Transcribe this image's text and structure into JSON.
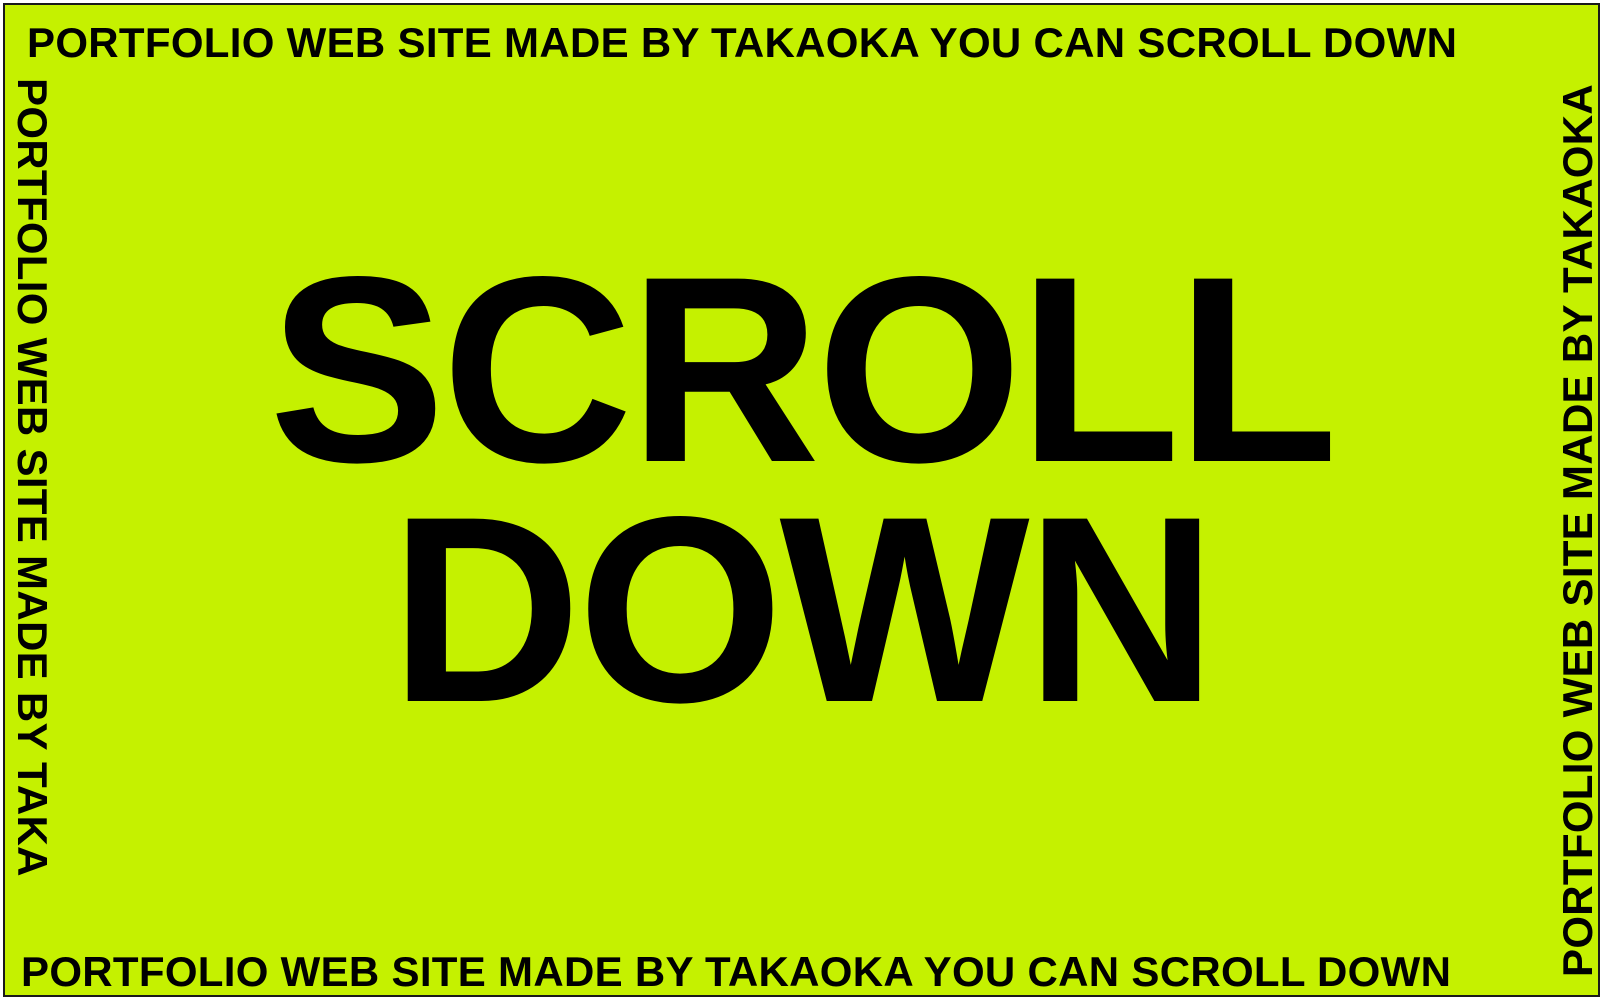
{
  "theme": {
    "background": "#c5f100",
    "text": "#000000",
    "border": "#1a1a1a"
  },
  "marquee": {
    "top": "PORTFOLIO WEB SITE MADE BY TAKAOKA YOU CAN SCROLL DOWN",
    "bottom": "PORTFOLIO WEB SITE MADE BY TAKAOKA YOU CAN SCROLL DOWN",
    "left": "PORTFOLIO WEB SITE MADE BY TAKA",
    "right": "PORTFOLIO WEB SITE MADE BY TAKAOKA"
  },
  "hero": {
    "line1": "SCROLL",
    "line2": "DOWN"
  }
}
